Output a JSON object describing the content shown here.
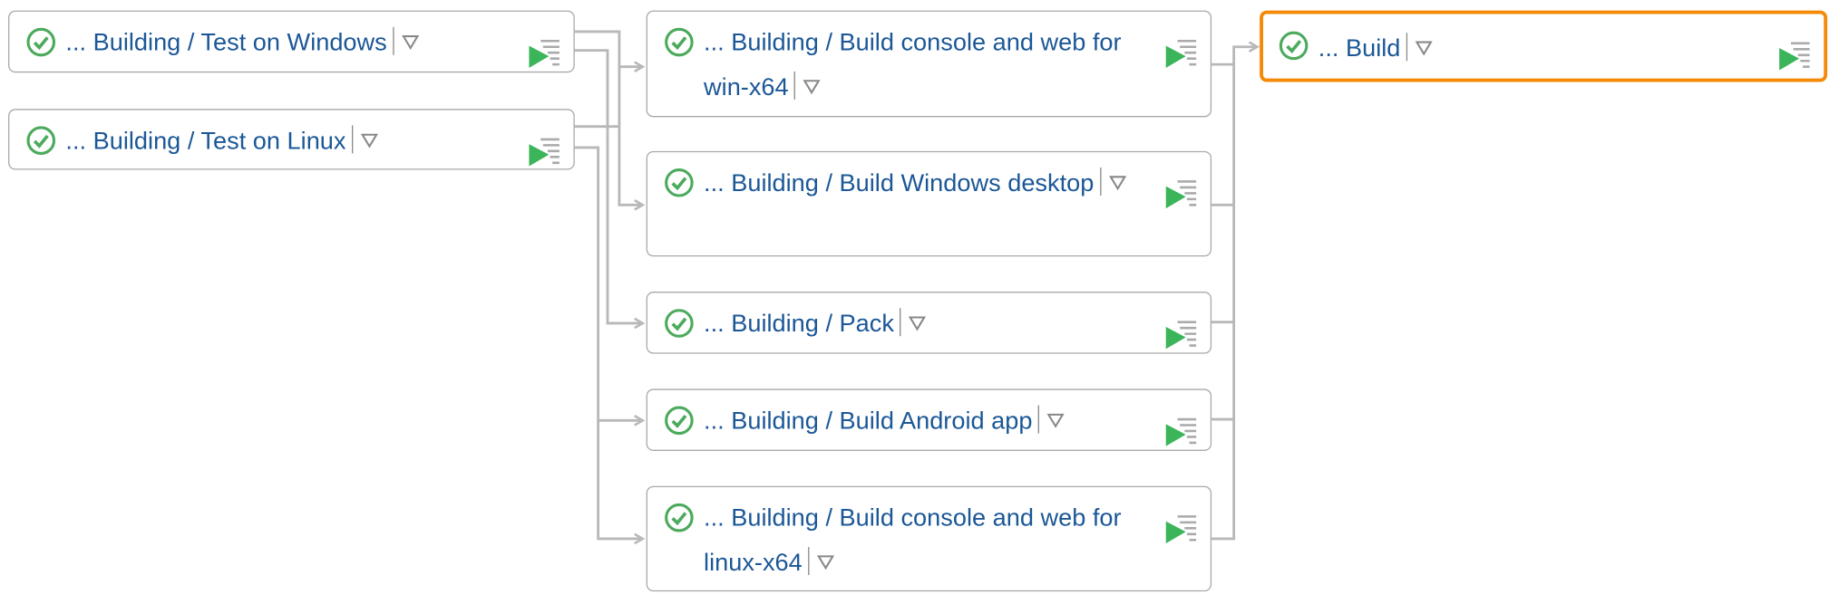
{
  "colors": {
    "text": "#1b5797",
    "success": "#4caa5c",
    "selected_border": "#f58a07",
    "connector": "#b8b8b8"
  },
  "nodes": [
    {
      "id": "test-windows",
      "status": "success",
      "prefix": "...",
      "label": "Building / Test on Windows"
    },
    {
      "id": "test-linux",
      "status": "success",
      "prefix": "...",
      "label": "Building / Test on Linux"
    },
    {
      "id": "build-win-x64",
      "status": "success",
      "prefix": "...",
      "label": "Building / Build console and web for win-x64"
    },
    {
      "id": "build-windows-desktop",
      "status": "success",
      "prefix": "...",
      "label": "Building / Build Windows desktop"
    },
    {
      "id": "pack",
      "status": "success",
      "prefix": "...",
      "label": "Building / Pack"
    },
    {
      "id": "build-android",
      "status": "success",
      "prefix": "...",
      "label": "Building / Build Android app"
    },
    {
      "id": "build-linux-x64",
      "status": "success",
      "prefix": "...",
      "label": "Building / Build console and web for linux-x64"
    },
    {
      "id": "build",
      "status": "success",
      "prefix": "...",
      "label": "Build",
      "selected": true
    }
  ],
  "icons": {
    "status": "check-circle-icon",
    "menu": "triangle-down-icon",
    "log": "build-log-icon"
  }
}
